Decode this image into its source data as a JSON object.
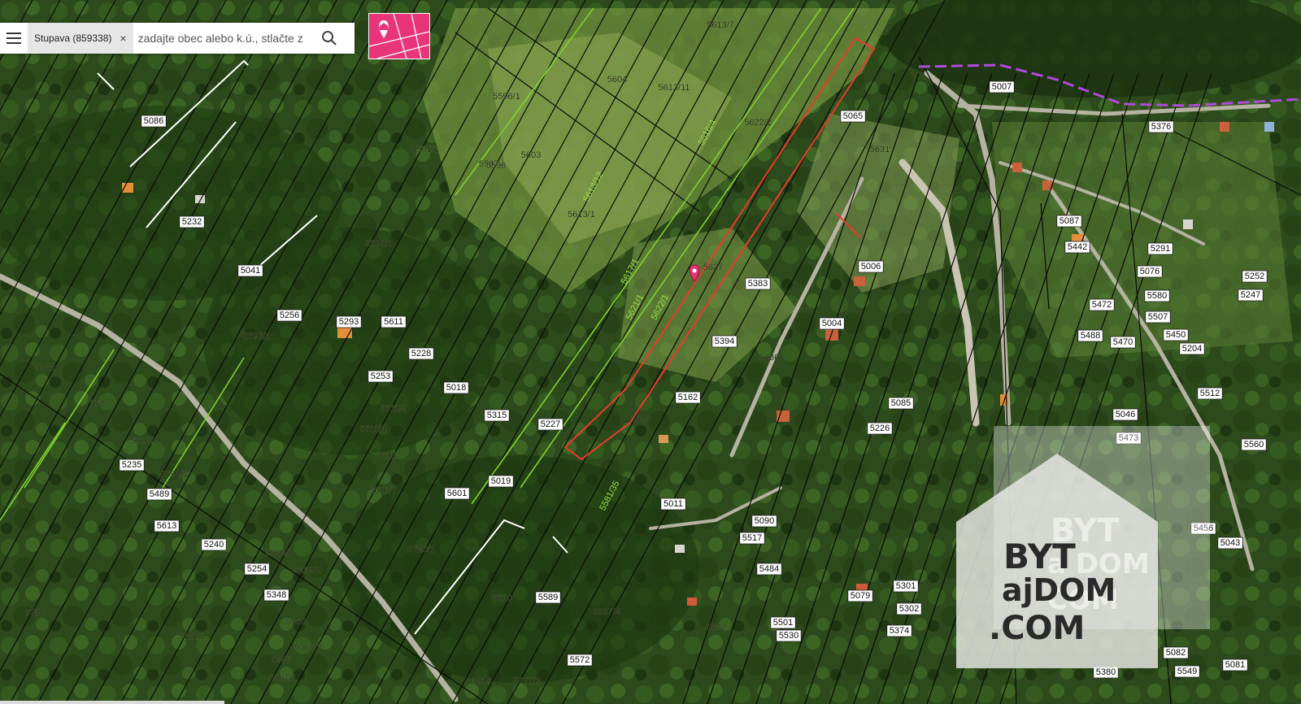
{
  "search": {
    "chip_label": "Stupava (859338)",
    "chip_close": "×",
    "placeholder": "zadajte obec alebo k.ú., stlačte z"
  },
  "watermark": {
    "line1": "BYT",
    "line2": "ajDOM",
    "line3": ".COM",
    "ghost1": "BYT",
    "ghost2": "a DOM",
    "ghost3": "COM"
  },
  "colors": {
    "parcel_line": "#0b0b0b",
    "green_line": "#7fd22c",
    "highlight": "#e83b2b",
    "marker": "#e8357a",
    "border_dash": "#b04ad8"
  },
  "parcel_labels": [
    {
      "t": "5613/7"
    },
    {
      "t": "5604"
    },
    {
      "t": "5613/11"
    },
    {
      "t": "5596/1"
    },
    {
      "t": "5603"
    },
    {
      "t": "5597"
    },
    {
      "t": "5613/12"
    },
    {
      "t": "5613/1"
    },
    {
      "t": "5622/2"
    },
    {
      "t": "5616/4"
    },
    {
      "t": "5617/1"
    },
    {
      "t": "5627"
    },
    {
      "t": "5621/1"
    },
    {
      "t": "5622/1"
    },
    {
      "t": "5086"
    },
    {
      "t": "5232"
    },
    {
      "t": "5041"
    },
    {
      "t": "5256"
    },
    {
      "t": "5293"
    },
    {
      "t": "5611"
    },
    {
      "t": "5228"
    },
    {
      "t": "5253"
    },
    {
      "t": "5018"
    },
    {
      "t": "5315"
    },
    {
      "t": "5227"
    },
    {
      "t": "5019"
    },
    {
      "t": "5601"
    },
    {
      "t": "5235"
    },
    {
      "t": "5489"
    },
    {
      "t": "5613"
    },
    {
      "t": "5240"
    },
    {
      "t": "5254"
    },
    {
      "t": "5348"
    },
    {
      "t": "5589"
    },
    {
      "t": "5572"
    },
    {
      "t": "5011"
    },
    {
      "t": "5090"
    },
    {
      "t": "5517"
    },
    {
      "t": "5484"
    },
    {
      "t": "5079"
    },
    {
      "t": "5301"
    },
    {
      "t": "5302"
    },
    {
      "t": "5374"
    },
    {
      "t": "5501"
    },
    {
      "t": "5530"
    },
    {
      "t": "5162"
    },
    {
      "t": "5394"
    },
    {
      "t": "5383"
    },
    {
      "t": "5006"
    },
    {
      "t": "5004"
    },
    {
      "t": "5085"
    },
    {
      "t": "5226"
    },
    {
      "t": "5065"
    },
    {
      "t": "5007"
    },
    {
      "t": "5376"
    },
    {
      "t": "5087"
    },
    {
      "t": "5442"
    },
    {
      "t": "5291"
    },
    {
      "t": "5076"
    },
    {
      "t": "5580"
    },
    {
      "t": "5507"
    },
    {
      "t": "5472"
    },
    {
      "t": "5488"
    },
    {
      "t": "5470"
    },
    {
      "t": "5450"
    },
    {
      "t": "5204"
    },
    {
      "t": "5512"
    },
    {
      "t": "5046"
    },
    {
      "t": "5252"
    },
    {
      "t": "5247"
    },
    {
      "t": "5560"
    },
    {
      "t": "5043"
    },
    {
      "t": "5082"
    },
    {
      "t": "5380"
    },
    {
      "t": "5549"
    },
    {
      "t": "5081"
    },
    {
      "t": "5473"
    },
    {
      "t": "5456"
    },
    {
      "t": "5595/1"
    },
    {
      "t": "5591/1"
    },
    {
      "t": "5596"
    },
    {
      "t": "5592/1"
    },
    {
      "t": "5582"
    },
    {
      "t": "5587"
    },
    {
      "t": "5593/1"
    },
    {
      "t": "5594/1"
    },
    {
      "t": "5611/1"
    },
    {
      "t": "5611/2"
    },
    {
      "t": "5615"
    },
    {
      "t": "5616/7"
    },
    {
      "t": "5620/1"
    },
    {
      "t": "5368/1"
    },
    {
      "t": "5368/2"
    },
    {
      "t": "5369"
    },
    {
      "t": "5367/2"
    },
    {
      "t": "5321/1"
    },
    {
      "t": "5308"
    },
    {
      "t": "5487"
    },
    {
      "t": "5367/1"
    },
    {
      "t": "5610"
    },
    {
      "t": "5537/4"
    },
    {
      "t": "5614"
    },
    {
      "t": "5577/2"
    },
    {
      "t": "5636"
    },
    {
      "t": "5631"
    },
    {
      "t": "5628"
    },
    {
      "t": "5581/35"
    },
    {
      "t": "5642"
    }
  ]
}
